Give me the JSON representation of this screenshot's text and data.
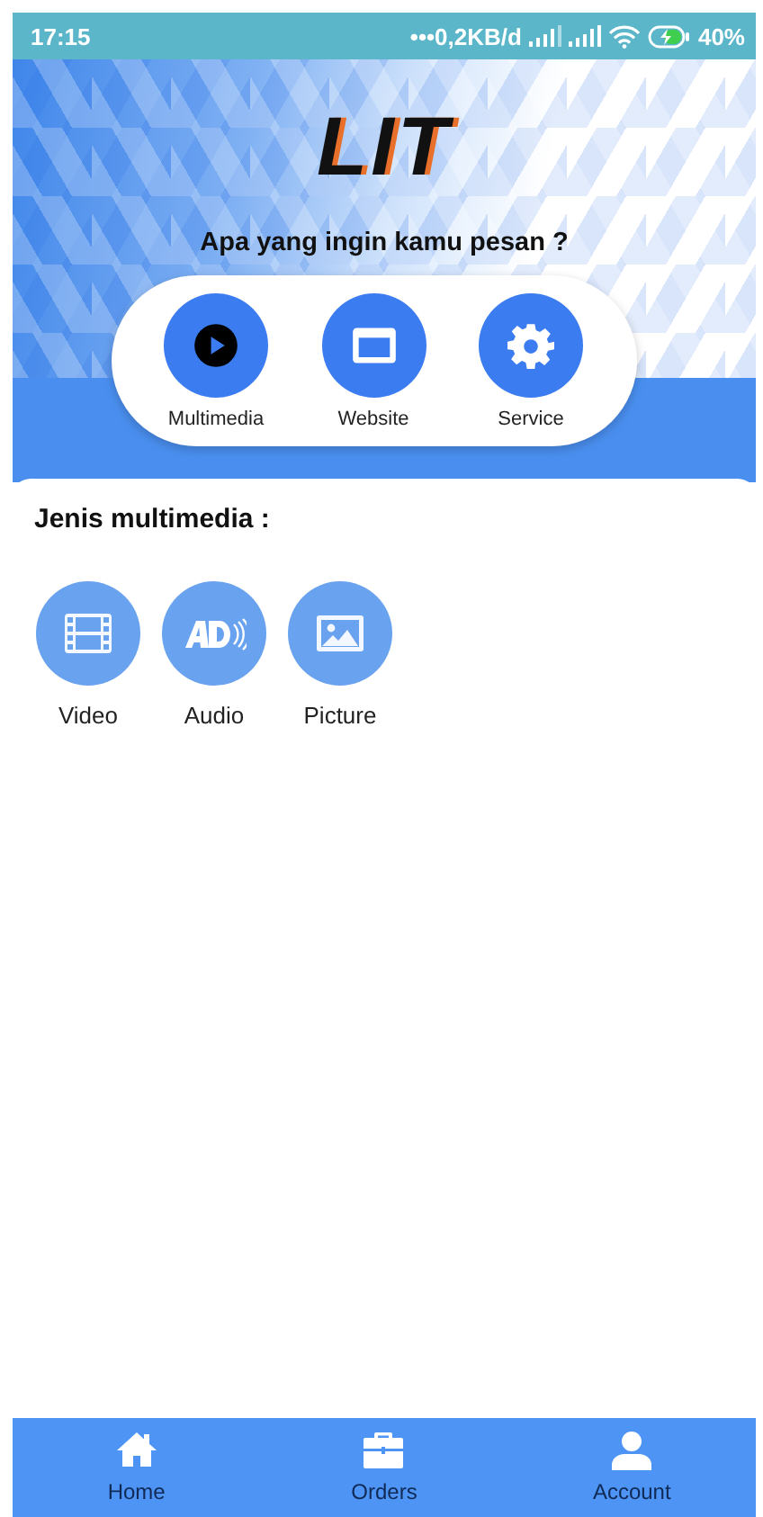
{
  "status_bar": {
    "time": "17:15",
    "network_speed": "•••0,2KB/d",
    "battery": "40%"
  },
  "header": {
    "logo": "LIT",
    "question": "Apa yang ingin kamu pesan ?"
  },
  "categories": [
    {
      "label": "Multimedia"
    },
    {
      "label": "Website"
    },
    {
      "label": "Service"
    }
  ],
  "section": {
    "title": "Jenis multimedia :",
    "items": [
      {
        "label": "Video"
      },
      {
        "label": "Audio"
      },
      {
        "label": "Picture"
      }
    ]
  },
  "bottom_nav": [
    {
      "label": "Home"
    },
    {
      "label": "Orders"
    },
    {
      "label": "Account"
    }
  ]
}
